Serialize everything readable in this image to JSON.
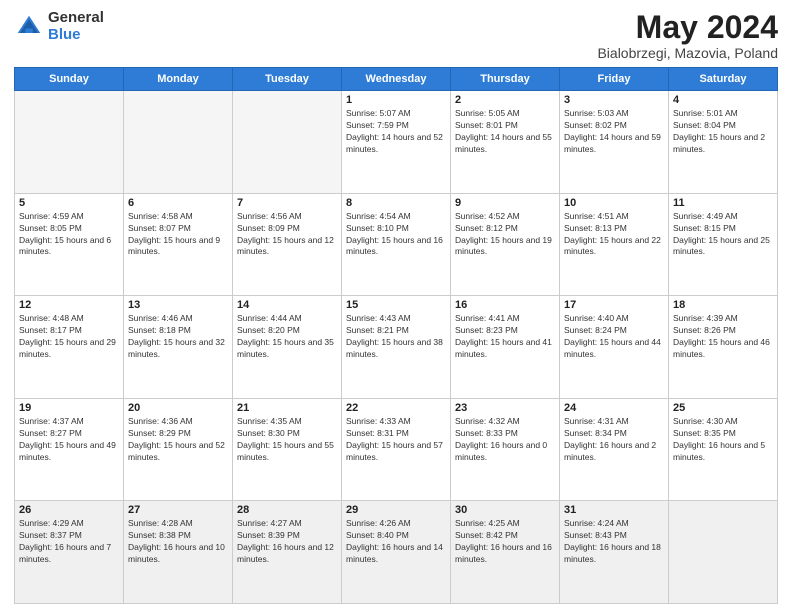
{
  "logo": {
    "general": "General",
    "blue": "Blue"
  },
  "title": {
    "month": "May 2024",
    "location": "Bialobrzegi, Mazovia, Poland"
  },
  "days_of_week": [
    "Sunday",
    "Monday",
    "Tuesday",
    "Wednesday",
    "Thursday",
    "Friday",
    "Saturday"
  ],
  "weeks": [
    [
      {
        "day": "",
        "sunrise": "",
        "sunset": "",
        "daylight": "",
        "empty": true
      },
      {
        "day": "",
        "sunrise": "",
        "sunset": "",
        "daylight": "",
        "empty": true
      },
      {
        "day": "",
        "sunrise": "",
        "sunset": "",
        "daylight": "",
        "empty": true
      },
      {
        "day": "1",
        "sunrise": "Sunrise: 5:07 AM",
        "sunset": "Sunset: 7:59 PM",
        "daylight": "Daylight: 14 hours and 52 minutes."
      },
      {
        "day": "2",
        "sunrise": "Sunrise: 5:05 AM",
        "sunset": "Sunset: 8:01 PM",
        "daylight": "Daylight: 14 hours and 55 minutes."
      },
      {
        "day": "3",
        "sunrise": "Sunrise: 5:03 AM",
        "sunset": "Sunset: 8:02 PM",
        "daylight": "Daylight: 14 hours and 59 minutes."
      },
      {
        "day": "4",
        "sunrise": "Sunrise: 5:01 AM",
        "sunset": "Sunset: 8:04 PM",
        "daylight": "Daylight: 15 hours and 2 minutes."
      }
    ],
    [
      {
        "day": "5",
        "sunrise": "Sunrise: 4:59 AM",
        "sunset": "Sunset: 8:05 PM",
        "daylight": "Daylight: 15 hours and 6 minutes."
      },
      {
        "day": "6",
        "sunrise": "Sunrise: 4:58 AM",
        "sunset": "Sunset: 8:07 PM",
        "daylight": "Daylight: 15 hours and 9 minutes."
      },
      {
        "day": "7",
        "sunrise": "Sunrise: 4:56 AM",
        "sunset": "Sunset: 8:09 PM",
        "daylight": "Daylight: 15 hours and 12 minutes."
      },
      {
        "day": "8",
        "sunrise": "Sunrise: 4:54 AM",
        "sunset": "Sunset: 8:10 PM",
        "daylight": "Daylight: 15 hours and 16 minutes."
      },
      {
        "day": "9",
        "sunrise": "Sunrise: 4:52 AM",
        "sunset": "Sunset: 8:12 PM",
        "daylight": "Daylight: 15 hours and 19 minutes."
      },
      {
        "day": "10",
        "sunrise": "Sunrise: 4:51 AM",
        "sunset": "Sunset: 8:13 PM",
        "daylight": "Daylight: 15 hours and 22 minutes."
      },
      {
        "day": "11",
        "sunrise": "Sunrise: 4:49 AM",
        "sunset": "Sunset: 8:15 PM",
        "daylight": "Daylight: 15 hours and 25 minutes."
      }
    ],
    [
      {
        "day": "12",
        "sunrise": "Sunrise: 4:48 AM",
        "sunset": "Sunset: 8:17 PM",
        "daylight": "Daylight: 15 hours and 29 minutes."
      },
      {
        "day": "13",
        "sunrise": "Sunrise: 4:46 AM",
        "sunset": "Sunset: 8:18 PM",
        "daylight": "Daylight: 15 hours and 32 minutes."
      },
      {
        "day": "14",
        "sunrise": "Sunrise: 4:44 AM",
        "sunset": "Sunset: 8:20 PM",
        "daylight": "Daylight: 15 hours and 35 minutes."
      },
      {
        "day": "15",
        "sunrise": "Sunrise: 4:43 AM",
        "sunset": "Sunset: 8:21 PM",
        "daylight": "Daylight: 15 hours and 38 minutes."
      },
      {
        "day": "16",
        "sunrise": "Sunrise: 4:41 AM",
        "sunset": "Sunset: 8:23 PM",
        "daylight": "Daylight: 15 hours and 41 minutes."
      },
      {
        "day": "17",
        "sunrise": "Sunrise: 4:40 AM",
        "sunset": "Sunset: 8:24 PM",
        "daylight": "Daylight: 15 hours and 44 minutes."
      },
      {
        "day": "18",
        "sunrise": "Sunrise: 4:39 AM",
        "sunset": "Sunset: 8:26 PM",
        "daylight": "Daylight: 15 hours and 46 minutes."
      }
    ],
    [
      {
        "day": "19",
        "sunrise": "Sunrise: 4:37 AM",
        "sunset": "Sunset: 8:27 PM",
        "daylight": "Daylight: 15 hours and 49 minutes."
      },
      {
        "day": "20",
        "sunrise": "Sunrise: 4:36 AM",
        "sunset": "Sunset: 8:29 PM",
        "daylight": "Daylight: 15 hours and 52 minutes."
      },
      {
        "day": "21",
        "sunrise": "Sunrise: 4:35 AM",
        "sunset": "Sunset: 8:30 PM",
        "daylight": "Daylight: 15 hours and 55 minutes."
      },
      {
        "day": "22",
        "sunrise": "Sunrise: 4:33 AM",
        "sunset": "Sunset: 8:31 PM",
        "daylight": "Daylight: 15 hours and 57 minutes."
      },
      {
        "day": "23",
        "sunrise": "Sunrise: 4:32 AM",
        "sunset": "Sunset: 8:33 PM",
        "daylight": "Daylight: 16 hours and 0 minutes."
      },
      {
        "day": "24",
        "sunrise": "Sunrise: 4:31 AM",
        "sunset": "Sunset: 8:34 PM",
        "daylight": "Daylight: 16 hours and 2 minutes."
      },
      {
        "day": "25",
        "sunrise": "Sunrise: 4:30 AM",
        "sunset": "Sunset: 8:35 PM",
        "daylight": "Daylight: 16 hours and 5 minutes."
      }
    ],
    [
      {
        "day": "26",
        "sunrise": "Sunrise: 4:29 AM",
        "sunset": "Sunset: 8:37 PM",
        "daylight": "Daylight: 16 hours and 7 minutes.",
        "last": true
      },
      {
        "day": "27",
        "sunrise": "Sunrise: 4:28 AM",
        "sunset": "Sunset: 8:38 PM",
        "daylight": "Daylight: 16 hours and 10 minutes.",
        "last": true
      },
      {
        "day": "28",
        "sunrise": "Sunrise: 4:27 AM",
        "sunset": "Sunset: 8:39 PM",
        "daylight": "Daylight: 16 hours and 12 minutes.",
        "last": true
      },
      {
        "day": "29",
        "sunrise": "Sunrise: 4:26 AM",
        "sunset": "Sunset: 8:40 PM",
        "daylight": "Daylight: 16 hours and 14 minutes.",
        "last": true
      },
      {
        "day": "30",
        "sunrise": "Sunrise: 4:25 AM",
        "sunset": "Sunset: 8:42 PM",
        "daylight": "Daylight: 16 hours and 16 minutes.",
        "last": true
      },
      {
        "day": "31",
        "sunrise": "Sunrise: 4:24 AM",
        "sunset": "Sunset: 8:43 PM",
        "daylight": "Daylight: 16 hours and 18 minutes.",
        "last": true
      },
      {
        "day": "",
        "sunrise": "",
        "sunset": "",
        "daylight": "",
        "empty": true,
        "last": true
      }
    ]
  ]
}
